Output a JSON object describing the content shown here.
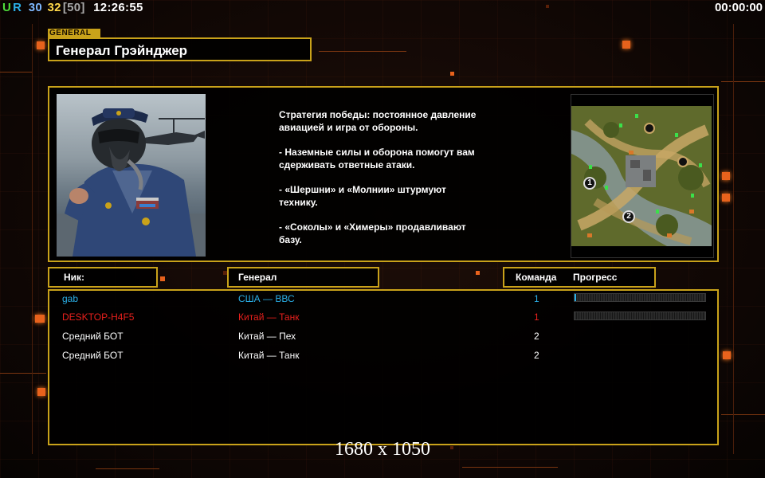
{
  "hud": {
    "stat_ur_u": "U",
    "stat_ur_r": "R",
    "stat_a": "30",
    "stat_b": "32",
    "stat_c": "[50]",
    "clock": "12:26:55",
    "timer": "00:00:00"
  },
  "general": {
    "tag": "GENERAL",
    "name": "Генерал Грэйнджер"
  },
  "briefing": {
    "paragraphs": [
      "Стратегия победы: постоянное давление\n авиацией и игра от обороны.",
      "- Наземные силы и оборона помогут вам\n сдерживать ответные атаки.",
      "- «Шершни» и «Молнии» штурмуют\n технику.",
      "- «Соколы» и «Химеры» продавливают\n базу."
    ],
    "map_markers": [
      "1",
      "2"
    ]
  },
  "table": {
    "headers": {
      "nick": "Ник:",
      "general": "Генерал",
      "team": "Команда",
      "progress": "Прогресс"
    },
    "rows": [
      {
        "nick": "gab",
        "general": "США — ВВС",
        "team": "1",
        "color": "#2bb0e8",
        "progress": 0.01,
        "show_progress": true
      },
      {
        "nick": "DESKTOP-H4F5",
        "general": "Китай — Танк",
        "team": "1",
        "color": "#e8201c",
        "progress": 0,
        "show_progress": true
      },
      {
        "nick": "Средний БОТ",
        "general": "Китай — Пех",
        "team": "2",
        "color": "#ffffff",
        "progress": 0,
        "show_progress": false
      },
      {
        "nick": "Средний БОТ",
        "general": "Китай — Танк",
        "team": "2",
        "color": "#ffffff",
        "progress": 0,
        "show_progress": false
      }
    ]
  },
  "footer": {
    "resolution": "1680 x 1050"
  },
  "colors": {
    "frame": "#c9a21a",
    "accent": "#e8621c"
  }
}
